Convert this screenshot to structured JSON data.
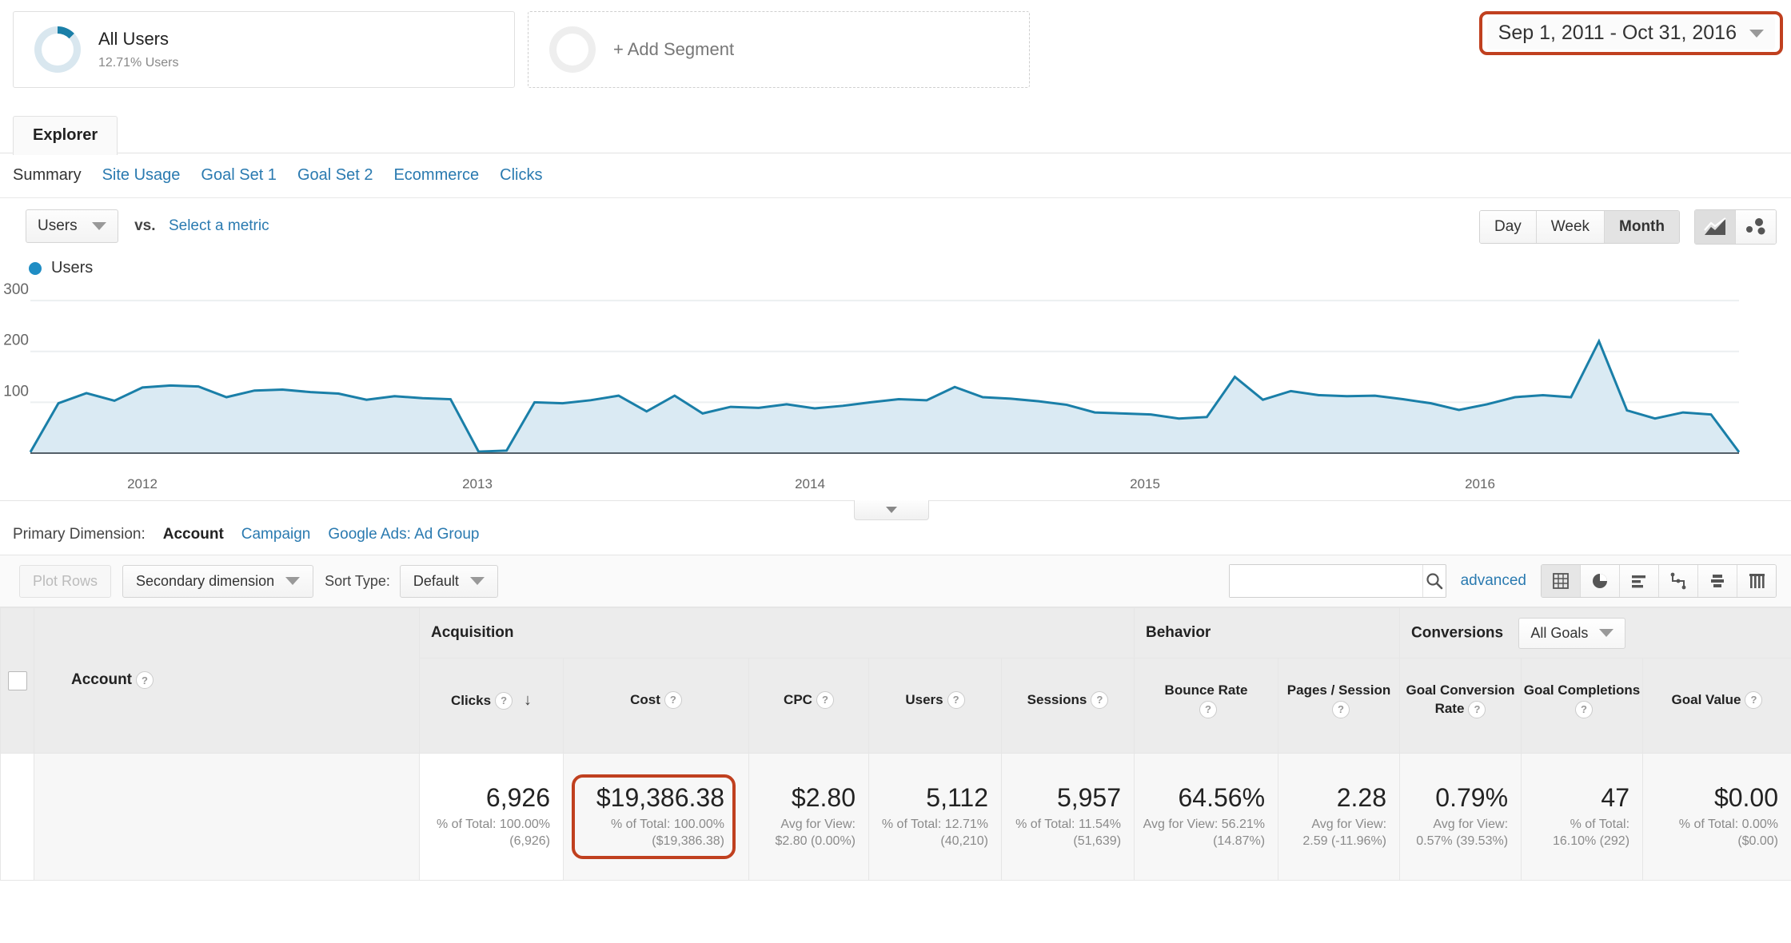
{
  "segments": {
    "all_users": {
      "title": "All Users",
      "subtitle": "12.71% Users",
      "donut_percent": 12.71,
      "donut_color": "#1a7fa8"
    },
    "add_segment": {
      "label": "+ Add Segment"
    }
  },
  "date_range": {
    "value": "Sep 1, 2011 - Oct 31, 2016",
    "highlight_color": "#c0401f"
  },
  "tabs": {
    "explorer": "Explorer"
  },
  "subnav": {
    "items": [
      {
        "label": "Summary",
        "active": true
      },
      {
        "label": "Site Usage",
        "active": false
      },
      {
        "label": "Goal Set 1",
        "active": false
      },
      {
        "label": "Goal Set 2",
        "active": false
      },
      {
        "label": "Ecommerce",
        "active": false
      },
      {
        "label": "Clicks",
        "active": false
      }
    ]
  },
  "metric_row": {
    "metric_selected": "Users",
    "vs_label": "vs.",
    "select_metric_link": "Select a metric",
    "granularity": [
      {
        "label": "Day",
        "active": false
      },
      {
        "label": "Week",
        "active": false
      },
      {
        "label": "Month",
        "active": true
      }
    ],
    "chart_type_icons": [
      {
        "name": "line-chart-icon",
        "active": true
      },
      {
        "name": "motion-chart-icon",
        "active": false
      }
    ]
  },
  "chart_data": {
    "type": "area",
    "title": "",
    "legend": [
      "Users"
    ],
    "legend_position": "top-left",
    "series_color": "#1a7fa8",
    "fill_color": "#daeaf3",
    "xlabel": "",
    "ylabel": "",
    "ylim": [
      0,
      330
    ],
    "yticks": [
      100,
      200,
      300
    ],
    "grid": true,
    "xtick_labels": [
      "2012",
      "2013",
      "2014",
      "2015",
      "2016"
    ],
    "x": [
      "Sep 2011",
      "Oct 2011",
      "Nov 2011",
      "Dec 2011",
      "Jan 2012",
      "Feb 2012",
      "Mar 2012",
      "Apr 2012",
      "May 2012",
      "Jun 2012",
      "Jul 2012",
      "Aug 2012",
      "Sep 2012",
      "Oct 2012",
      "Nov 2012",
      "Dec 2012",
      "Jan 2013",
      "Feb 2013",
      "Mar 2013",
      "Apr 2013",
      "May 2013",
      "Jun 2013",
      "Jul 2013",
      "Aug 2013",
      "Sep 2013",
      "Oct 2013",
      "Nov 2013",
      "Dec 2013",
      "Jan 2014",
      "Feb 2014",
      "Mar 2014",
      "Apr 2014",
      "May 2014",
      "Jun 2014",
      "Jul 2014",
      "Aug 2014",
      "Sep 2014",
      "Oct 2014",
      "Nov 2014",
      "Dec 2014",
      "Jan 2015",
      "Feb 2015",
      "Mar 2015",
      "Apr 2015",
      "May 2015",
      "Jun 2015",
      "Jul 2015",
      "Aug 2015",
      "Sep 2015",
      "Oct 2015",
      "Nov 2015",
      "Dec 2015",
      "Jan 2016",
      "Feb 2016",
      "Mar 2016",
      "Apr 2016",
      "May 2016",
      "Jun 2016",
      "Jul 2016",
      "Aug 2016",
      "Sep 2016",
      "Oct 2016"
    ],
    "values": [
      2,
      98,
      118,
      103,
      129,
      133,
      131,
      110,
      123,
      125,
      120,
      117,
      105,
      112,
      108,
      106,
      3,
      5,
      100,
      98,
      104,
      113,
      82,
      113,
      78,
      91,
      89,
      96,
      88,
      93,
      100,
      106,
      104,
      130,
      110,
      107,
      102,
      95,
      80,
      78,
      76,
      68,
      71,
      150,
      105,
      122,
      114,
      112,
      113,
      106,
      98,
      85,
      96,
      110,
      114,
      110,
      220,
      84,
      68,
      80,
      76,
      2
    ],
    "series": [
      {
        "name": "Users",
        "values": [
          2,
          98,
          118,
          103,
          129,
          133,
          131,
          110,
          123,
          125,
          120,
          117,
          105,
          112,
          108,
          106,
          3,
          5,
          100,
          98,
          104,
          113,
          82,
          113,
          78,
          91,
          89,
          96,
          88,
          93,
          100,
          106,
          104,
          130,
          110,
          107,
          102,
          95,
          80,
          78,
          76,
          68,
          71,
          150,
          105,
          122,
          114,
          112,
          113,
          106,
          98,
          85,
          96,
          110,
          114,
          110,
          220,
          84,
          68,
          80,
          76,
          2
        ]
      }
    ]
  },
  "primary_dimension": {
    "label": "Primary Dimension:",
    "options": [
      {
        "label": "Account",
        "active": true
      },
      {
        "label": "Campaign",
        "active": false
      },
      {
        "label": "Google Ads: Ad Group",
        "active": false
      }
    ]
  },
  "table_toolbar": {
    "plot_rows": "Plot Rows",
    "secondary_dimension": "Secondary dimension",
    "sort_type_label": "Sort Type:",
    "sort_type_value": "Default",
    "search_value": "",
    "search_placeholder": "",
    "advanced": "advanced",
    "view_icons": [
      {
        "name": "table-view-icon",
        "active": true
      },
      {
        "name": "pie-view-icon",
        "active": false
      },
      {
        "name": "bar-view-icon",
        "active": false
      },
      {
        "name": "comparison-view-icon",
        "active": false
      },
      {
        "name": "pivot-view-icon",
        "active": false
      },
      {
        "name": "term-cloud-view-icon",
        "active": false
      }
    ]
  },
  "table": {
    "groups": [
      {
        "label": "Acquisition",
        "span": 5
      },
      {
        "label": "Behavior",
        "span": 2
      },
      {
        "label": "Conversions",
        "span": 3,
        "dropdown": "All Goals"
      }
    ],
    "dimension_header": "Account",
    "columns": [
      {
        "label": "Clicks",
        "sorted": true,
        "sort_dir": "desc"
      },
      {
        "label": "Cost"
      },
      {
        "label": "CPC"
      },
      {
        "label": "Users"
      },
      {
        "label": "Sessions"
      },
      {
        "label": "Bounce Rate"
      },
      {
        "label": "Pages / Session"
      },
      {
        "label": "Goal Conversion Rate"
      },
      {
        "label": "Goal Completions"
      },
      {
        "label": "Goal Value"
      }
    ],
    "summary_row": {
      "account": "",
      "cells": [
        {
          "value": "6,926",
          "sub": "% of Total: 100.00% (6,926)",
          "highlight": false
        },
        {
          "value": "$19,386.38",
          "sub": "% of Total: 100.00% ($19,386.38)",
          "highlight": true
        },
        {
          "value": "$2.80",
          "sub": "Avg for View: $2.80 (0.00%)",
          "highlight": false
        },
        {
          "value": "5,112",
          "sub": "% of Total: 12.71% (40,210)",
          "highlight": false
        },
        {
          "value": "5,957",
          "sub": "% of Total: 11.54% (51,639)",
          "highlight": false
        },
        {
          "value": "64.56%",
          "sub": "Avg for View: 56.21% (14.87%)",
          "highlight": false
        },
        {
          "value": "2.28",
          "sub": "Avg for View: 2.59 (-11.96%)",
          "highlight": false
        },
        {
          "value": "0.79%",
          "sub": "Avg for View: 0.57% (39.53%)",
          "highlight": false
        },
        {
          "value": "47",
          "sub": "% of Total: 16.10% (292)",
          "highlight": false
        },
        {
          "value": "$0.00",
          "sub": "% of Total: 0.00% ($0.00)",
          "highlight": false
        }
      ]
    }
  }
}
